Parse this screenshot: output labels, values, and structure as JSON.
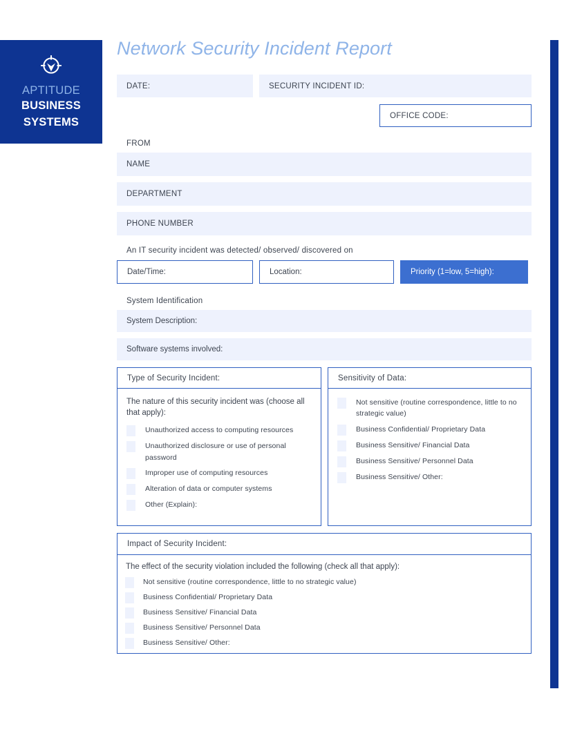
{
  "brand": {
    "icon": "crosshair-target-icon",
    "line1": "APTITUDE",
    "line2": "BUSINESS",
    "line3": "SYSTEMS",
    "bg_color": "#0e3492",
    "line1_color": "#8fb4e8",
    "line2_color": "#ffffff"
  },
  "document": {
    "title": "Network Security Incident Report",
    "title_color": "#8fb4e8"
  },
  "header_fields": {
    "date_label": "DATE:",
    "security_incident_id_label": "SECURITY INCIDENT ID:",
    "office_code_label": "OFFICE CODE:"
  },
  "from_section": {
    "heading": "FROM",
    "fields": [
      {
        "label": "NAME"
      },
      {
        "label": "DEPARTMENT"
      },
      {
        "label": "PHONE NUMBER"
      }
    ]
  },
  "detection": {
    "lead": "An IT security incident was detected/ observed/ discovered on",
    "date_time_label": "Date/Time:",
    "location_label": "Location:",
    "priority_label": "Priority (1=low, 5=high):",
    "priority_bg": "#3c6fd0"
  },
  "system_identification": {
    "heading": "System Identification",
    "fields": [
      {
        "label": "System Description:"
      },
      {
        "label": "Software systems involved:"
      }
    ]
  },
  "type_panel": {
    "heading": "Type of Security Incident:",
    "intro": "The nature of this security incident was (choose all that apply):",
    "options": [
      "Unauthorized access to computing resources",
      "Unauthorized disclosure or use of personal password",
      "Improper use of computing resources",
      "Alteration of data or computer systems",
      "Other (Explain):"
    ]
  },
  "sensitivity_panel": {
    "heading": "Sensitivity of Data:",
    "options": [
      "Not sensitive (routine correspondence, little to no strategic value)",
      "Business Confidential/ Proprietary Data",
      "Business Sensitive/ Financial Data",
      "Business Sensitive/ Personnel Data",
      "Business Sensitive/ Other:"
    ]
  },
  "impact_panel": {
    "heading": "Impact of Security Incident:",
    "intro": "The effect of the security violation included the following (check all that apply):",
    "options": [
      "Not sensitive (routine correspondence, little to no strategic value)",
      "Business Confidential/ Proprietary Data",
      "Business Sensitive/ Financial Data",
      "Business Sensitive/ Personnel Data",
      "Business Sensitive/ Other:"
    ]
  },
  "theme": {
    "field_fill": "#eef2fd",
    "border_blue": "#2f5fc0",
    "rail_color": "#0e3492",
    "text_color": "#3d4450"
  }
}
